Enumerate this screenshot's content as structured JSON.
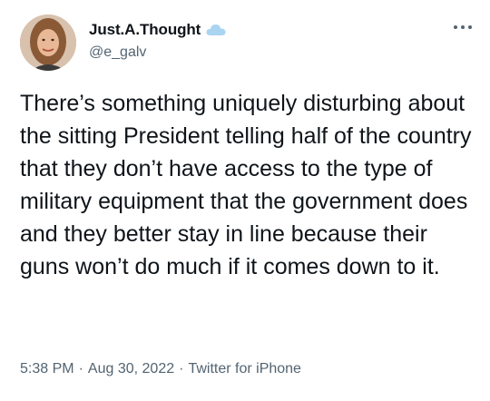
{
  "author": {
    "name": "Just.A.Thought",
    "name_emoji": "cloud-emoji",
    "handle": "@e_galv"
  },
  "tweet": {
    "text": "There’s something uniquely disturbing about the sitting President telling half of the country that they don’t have access to the type of military equipment that the government does and they better stay in line because their guns won’t do much if it comes down to it."
  },
  "meta": {
    "time": "5:38 PM",
    "date": "Aug 30, 2022",
    "source": "Twitter for iPhone",
    "separator": "·"
  },
  "icons": {
    "more": "more-horizontal-icon",
    "avatar": "profile-photo"
  },
  "colors": {
    "text": "#0f1419",
    "secondary": "#536471",
    "cloud": "#a9d4f2"
  }
}
